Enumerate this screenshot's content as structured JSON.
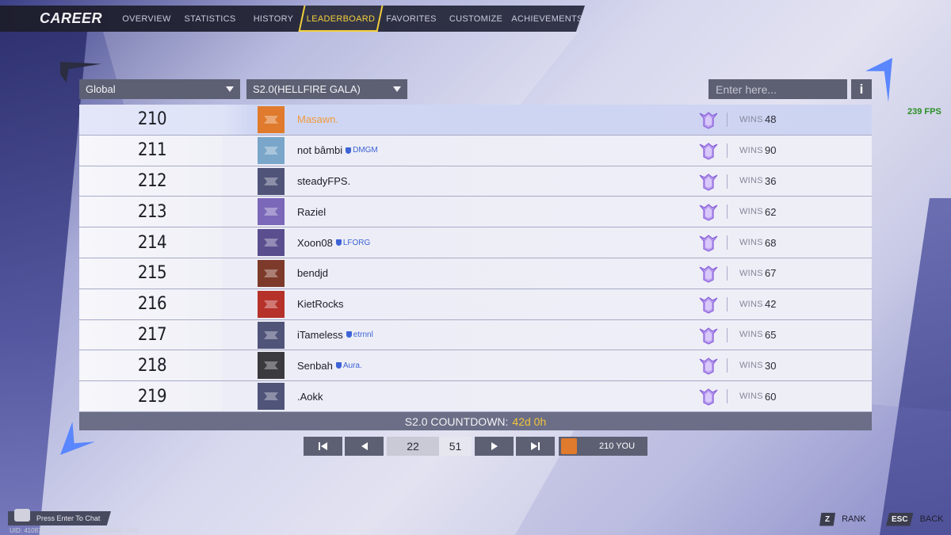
{
  "nav": {
    "title": "CAREER",
    "tabs": [
      "OVERVIEW",
      "STATISTICS",
      "HISTORY",
      "LEADERBOARD",
      "FAVORITES",
      "CUSTOMIZE",
      "ACHIEVEMENTS"
    ],
    "active_tab": "LEADERBOARD"
  },
  "filters": {
    "region": "Global",
    "season": "S2.0(HELLFIRE GALA)",
    "search_placeholder": "Enter here...",
    "info_label": "i"
  },
  "fps": "239 FPS",
  "wins_label": "WINS",
  "rows": [
    {
      "rank": "210",
      "name": "Masawn.",
      "tag": "",
      "wins": "48",
      "highlight": true,
      "avatar": "orange-hero-avatar-icon",
      "avatar_color": "#e07a2c"
    },
    {
      "rank": "211",
      "name": "not bâmbi",
      "tag": "DMGM",
      "wins": "90",
      "highlight": false,
      "avatar": "blonde-hero-avatar-icon",
      "avatar_color": "#7aa6c9"
    },
    {
      "rank": "212",
      "name": "steadyFPS.",
      "tag": "",
      "wins": "36",
      "highlight": false,
      "avatar": "default-logo-avatar-icon",
      "avatar_color": "#4f5478"
    },
    {
      "rank": "213",
      "name": "Raziel",
      "tag": "",
      "wins": "62",
      "highlight": false,
      "avatar": "top16-badge-avatar-icon",
      "avatar_color": "#7b68b8"
    },
    {
      "rank": "214",
      "name": "Xoon08",
      "tag": "LFORG",
      "wins": "68",
      "highlight": false,
      "avatar": "number-21-avatar-icon",
      "avatar_color": "#5a4e8e"
    },
    {
      "rank": "215",
      "name": "bendjd",
      "tag": "",
      "wins": "67",
      "highlight": false,
      "avatar": "skull-hero-avatar-icon",
      "avatar_color": "#7d3a2a"
    },
    {
      "rank": "216",
      "name": "KietRocks",
      "tag": "",
      "wins": "42",
      "highlight": false,
      "avatar": "red-armor-avatar-icon",
      "avatar_color": "#b5312a"
    },
    {
      "rank": "217",
      "name": "iTameless",
      "tag": "etrnnl",
      "wins": "65",
      "highlight": false,
      "avatar": "default-logo-avatar-icon",
      "avatar_color": "#4f5478"
    },
    {
      "rank": "218",
      "name": "Senbah",
      "tag": "Aura.",
      "wins": "30",
      "highlight": false,
      "avatar": "dark-hero-avatar-icon",
      "avatar_color": "#3a3a3f"
    },
    {
      "rank": "219",
      "name": ".Aokk",
      "tag": "",
      "wins": "60",
      "highlight": false,
      "avatar": "default-logo-avatar-icon",
      "avatar_color": "#4f5478"
    }
  ],
  "countdown": {
    "label": "S2.0 COUNTDOWN:",
    "time": "42d 0h"
  },
  "pagination": {
    "current_page": "22",
    "total_pages": "51",
    "you_label": "210 YOU"
  },
  "bottom": {
    "chat_label": "Press Enter To Chat",
    "uid": "UID: 41087966 | 1832036 | 2024080846-0000",
    "rank_key": "Z",
    "rank_label": "RANK",
    "back_key": "ESC",
    "back_label": "BACK"
  },
  "colors": {
    "accent_yellow": "#f3d03c",
    "highlight_name": "#f09a3c",
    "tag_blue": "#3d63d6",
    "rank_icon_purple": "#9a74e0",
    "fps_green": "#2a8f25"
  }
}
